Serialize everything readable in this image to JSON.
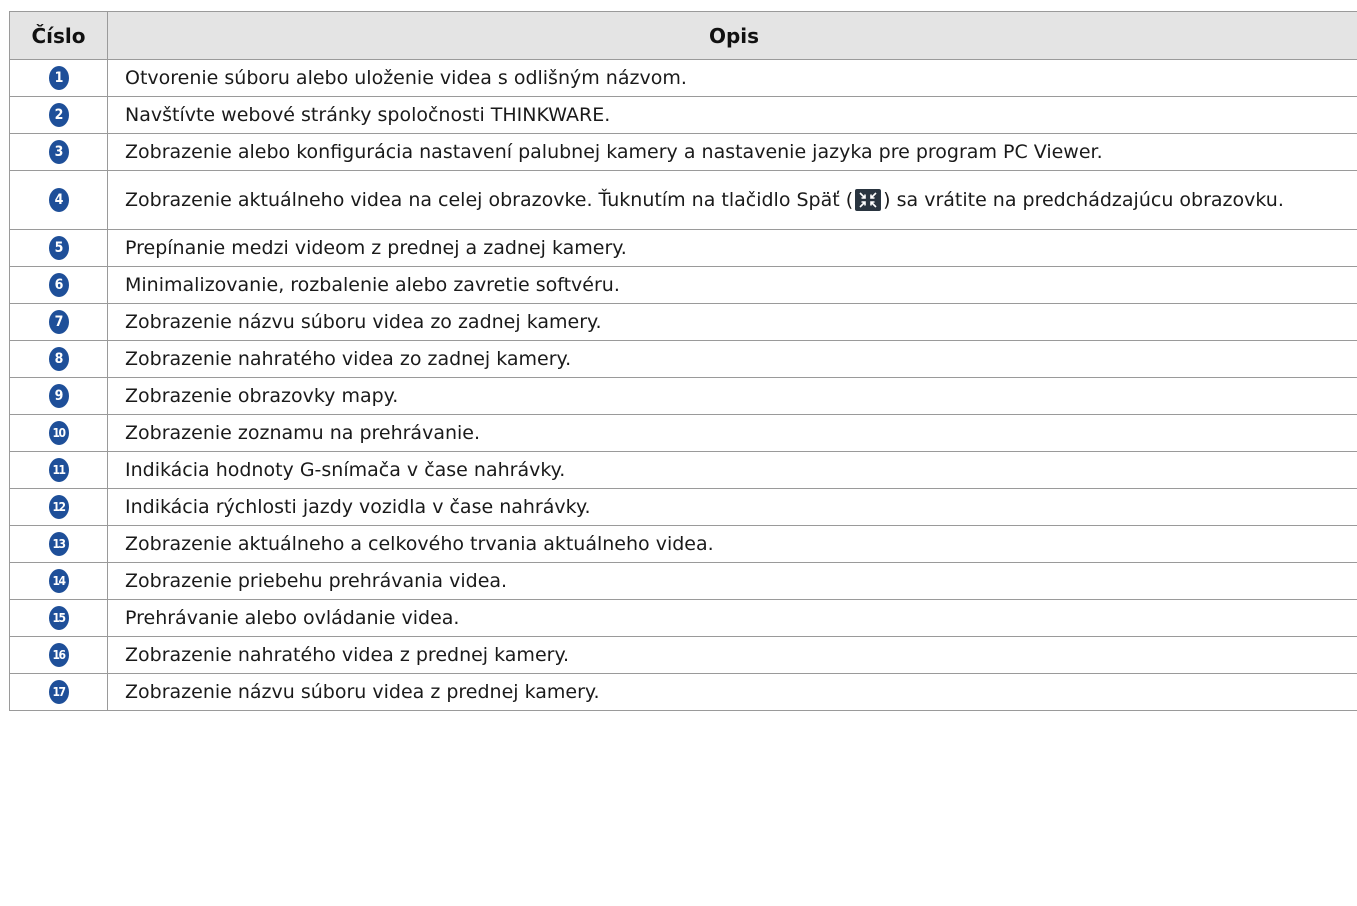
{
  "table": {
    "headers": {
      "number": "Číslo",
      "description": "Opis"
    },
    "rows": [
      {
        "num": "1",
        "text": "Otvorenie súboru alebo uloženie videa s odlišným názvom."
      },
      {
        "num": "2",
        "text": "Navštívte webové stránky spoločnosti THINKWARE."
      },
      {
        "num": "3",
        "text": "Zobrazenie alebo konfigurácia nastavení palubnej kamery a nastavenie jazyka pre program PC Viewer."
      },
      {
        "num": "4",
        "text_before_icon": "Zobrazenie aktuálneho videa na celej obrazovke. Ťuknutím na tlačidlo Späť (",
        "icon": "exit-fullscreen-icon",
        "text_after_icon": ") sa vrátite na predchádzajúcu obrazovku."
      },
      {
        "num": "5",
        "text": "Prepínanie medzi videom z prednej a zadnej kamery."
      },
      {
        "num": "6",
        "text": "Minimalizovanie, rozbalenie alebo zavretie softvéru."
      },
      {
        "num": "7",
        "text": "Zobrazenie názvu súboru videa zo zadnej kamery."
      },
      {
        "num": "8",
        "text": "Zobrazenie nahratého videa zo zadnej kamery."
      },
      {
        "num": "9",
        "text": "Zobrazenie obrazovky mapy."
      },
      {
        "num": "10",
        "text": "Zobrazenie zoznamu na prehrávanie."
      },
      {
        "num": "11",
        "text": "Indikácia hodnoty G-snímača v čase nahrávky."
      },
      {
        "num": "12",
        "text": "Indikácia rýchlosti jazdy vozidla v čase nahrávky."
      },
      {
        "num": "13",
        "text": "Zobrazenie aktuálneho a celkového trvania aktuálneho videa."
      },
      {
        "num": "14",
        "text": "Zobrazenie priebehu prehrávania videa."
      },
      {
        "num": "15",
        "text": "Prehrávanie alebo ovládanie videa."
      },
      {
        "num": "16",
        "text": "Zobrazenie nahratého videa z prednej kamery."
      },
      {
        "num": "17",
        "text": "Zobrazenie názvu súboru videa z prednej kamery."
      }
    ]
  },
  "colors": {
    "badge": "#1e4f99",
    "header_bg": "#e4e4e4",
    "border": "#9a9a9a"
  }
}
